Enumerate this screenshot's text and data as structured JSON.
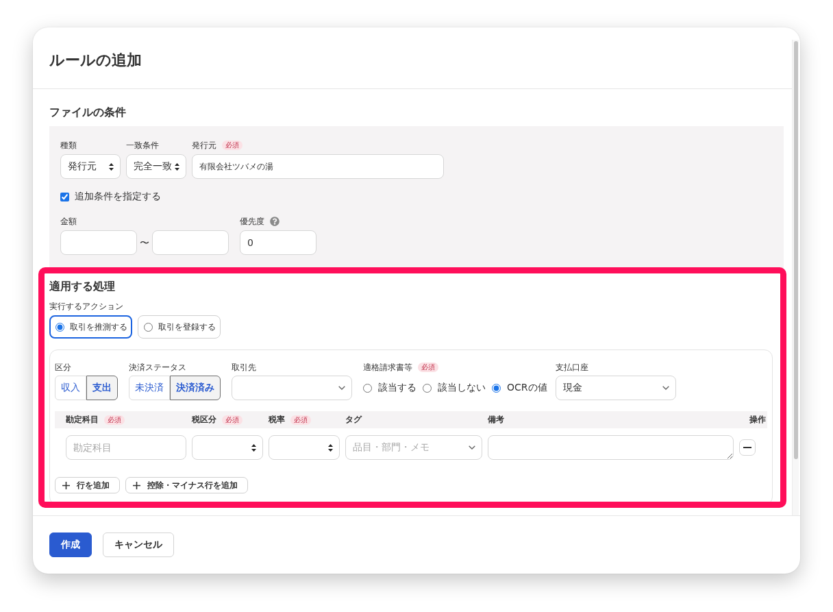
{
  "dialog": {
    "title": "ルールの追加"
  },
  "file_conditions": {
    "title": "ファイルの条件",
    "fields": [
      {
        "kind": "select",
        "label": "種類",
        "value": "発行元"
      },
      {
        "kind": "select",
        "label": "一致条件",
        "value": "完全一致"
      },
      {
        "kind": "text",
        "label": "発行元",
        "badge": "必須",
        "value": "有限会社ツバメの湯"
      }
    ],
    "extra_conditions": {
      "label": "追加条件を指定する",
      "checked": true
    },
    "amount": {
      "label": "金額",
      "separator": "〜"
    },
    "priority": {
      "label": "優先度",
      "value": "0"
    }
  },
  "processing": {
    "title": "適用する処理",
    "action_label": "実行するアクション",
    "actions": [
      {
        "label": "取引を推測する",
        "selected": true
      },
      {
        "label": "取引を登録する",
        "selected": false
      }
    ],
    "division": {
      "label": "区分",
      "options": [
        {
          "label": "収入",
          "selected": false
        },
        {
          "label": "支出",
          "selected": true
        }
      ]
    },
    "settlement": {
      "label": "決済ステータス",
      "options": [
        {
          "label": "未決済",
          "selected": false
        },
        {
          "label": "決済済み",
          "selected": true
        }
      ]
    },
    "partner": {
      "label": "取引先"
    },
    "invoice": {
      "label": "適格請求書等",
      "badge": "必須",
      "options": [
        {
          "label": "該当する",
          "selected": false
        },
        {
          "label": "該当しない",
          "selected": false
        },
        {
          "label": "OCRの値",
          "selected": true
        }
      ]
    },
    "account": {
      "label": "支払口座",
      "value": "現金"
    },
    "lines": {
      "columns": [
        {
          "label": "勘定科目",
          "badge": "必須"
        },
        {
          "label": "税区分",
          "badge": "必須"
        },
        {
          "label": "税率",
          "badge": "必須"
        },
        {
          "label": "タグ"
        },
        {
          "label": "備考"
        },
        {
          "label": "操作"
        }
      ],
      "rows": [
        {
          "cells": [
            {
              "kind": "input",
              "placeholder": "勘定科目"
            },
            {
              "kind": "select"
            },
            {
              "kind": "select"
            },
            {
              "kind": "combo",
              "placeholder": "品目・部門・メモ"
            },
            {
              "kind": "textarea"
            },
            {
              "kind": "remove"
            }
          ]
        }
      ]
    },
    "add_buttons": [
      {
        "label": "行を追加"
      },
      {
        "label": "控除・マイナス行を追加"
      }
    ]
  },
  "footer": {
    "buttons": [
      {
        "label": "作成",
        "kind": "primary"
      },
      {
        "label": "キャンセル",
        "kind": "secondary"
      }
    ]
  }
}
